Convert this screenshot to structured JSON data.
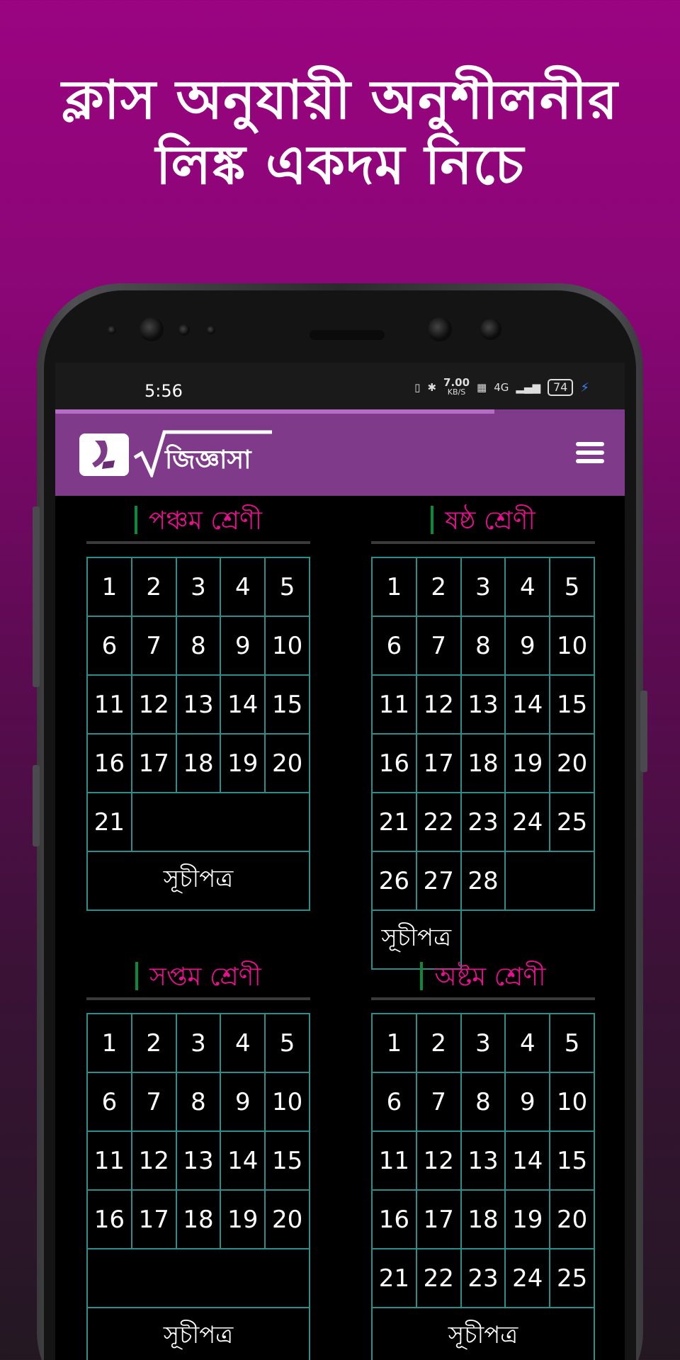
{
  "headline": {
    "line1": "ক্লাস অনুযায়ী অনুশীলনীর",
    "line2": "লিঙ্ক একদম নিচে"
  },
  "status": {
    "time": "5:56",
    "speed": "7.00",
    "speed_unit": "KB/S",
    "net": "4G",
    "battery": "74"
  },
  "app": {
    "logo_text": "জিজ্ঞাসা"
  },
  "colors": {
    "accent": "#7f3a8a",
    "heading": "#e8108f",
    "grid_line": "#2a8f8a"
  },
  "sections": [
    {
      "title": "পঞ্চম শ্রেণী",
      "chapters": [
        "1",
        "2",
        "3",
        "4",
        "5",
        "6",
        "7",
        "8",
        "9",
        "10",
        "11",
        "12",
        "13",
        "14",
        "15",
        "16",
        "17",
        "18",
        "19",
        "20",
        "21"
      ],
      "index_label": "সূচীপত্র"
    },
    {
      "title": "ষষ্ঠ শ্রেণী",
      "chapters": [
        "1",
        "2",
        "3",
        "4",
        "5",
        "6",
        "7",
        "8",
        "9",
        "10",
        "11",
        "12",
        "13",
        "14",
        "15",
        "16",
        "17",
        "18",
        "19",
        "20",
        "21",
        "22",
        "23",
        "24",
        "25",
        "26",
        "27",
        "28"
      ],
      "index_label": "সূচীপত্র"
    },
    {
      "title": "সপ্তম শ্রেণী",
      "chapters": [
        "1",
        "2",
        "3",
        "4",
        "5",
        "6",
        "7",
        "8",
        "9",
        "10",
        "11",
        "12",
        "13",
        "14",
        "15",
        "16",
        "17",
        "18",
        "19",
        "20"
      ],
      "index_label": "সূচীপত্র"
    },
    {
      "title": "অষ্টম শ্রেণী",
      "chapters": [
        "1",
        "2",
        "3",
        "4",
        "5",
        "6",
        "7",
        "8",
        "9",
        "10",
        "11",
        "12",
        "13",
        "14",
        "15",
        "16",
        "17",
        "18",
        "19",
        "20",
        "21",
        "22",
        "23",
        "24",
        "25"
      ],
      "index_label": "সূচীপত্র"
    }
  ]
}
